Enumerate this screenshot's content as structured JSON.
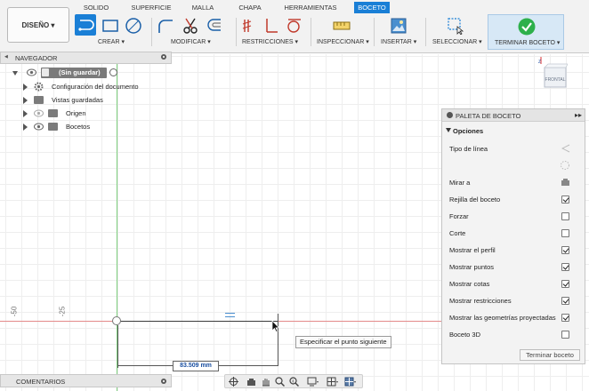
{
  "ribbon": {
    "tabs": [
      "SOLIDO",
      "SUPERFICIE",
      "MALLA",
      "CHAPA",
      "HERRAMIENTAS",
      "BOCETO"
    ],
    "design_button": "DISEÑO ▾",
    "groups": {
      "create": "CREAR ▾",
      "modify": "MODIFICAR ▾",
      "constraints": "RESTRICCIONES ▾",
      "inspect": "INSPECCIONAR ▾",
      "insert": "INSERTAR ▾",
      "select": "SELECCIONAR ▾",
      "finish": "TERMINAR BOCETO ▾"
    }
  },
  "navigator": {
    "title": "NAVEGADOR",
    "items": [
      {
        "label": "(Sin guardar)"
      },
      {
        "label": "Configuración del documento"
      },
      {
        "label": "Vistas guardadas"
      },
      {
        "label": "Origen"
      },
      {
        "label": "Bocetos"
      }
    ]
  },
  "palette": {
    "title": "PALETA DE BOCETO",
    "section": "Opciones",
    "rows": [
      {
        "label": "Tipo de línea"
      },
      {
        "label": "Mirar a"
      },
      {
        "label": "Rejilla del boceto",
        "checked": true
      },
      {
        "label": "Forzar",
        "checked": false
      },
      {
        "label": "Corte",
        "checked": false
      },
      {
        "label": "Mostrar el perfil",
        "checked": true
      },
      {
        "label": "Mostrar puntos",
        "checked": true
      },
      {
        "label": "Mostrar cotas",
        "checked": true
      },
      {
        "label": "Mostrar restricciones",
        "checked": true
      },
      {
        "label": "Mostrar las geometrías proyectadas",
        "checked": true
      },
      {
        "label": "Boceto 3D",
        "checked": false
      }
    ],
    "finish_button": "Terminar boceto"
  },
  "canvas": {
    "tooltip": "Especificar el punto siguiente",
    "dimension_value": "83.509 mm",
    "ruler_labels": [
      "-50",
      "-25"
    ],
    "viewcube_label": "FRONTAL"
  },
  "comments": {
    "title": "COMENTARIOS"
  },
  "colors": {
    "accent": "#1a7fd6",
    "finish_green": "#2db04b",
    "axis_red": "#e05050",
    "axis_green": "#5cc05c"
  }
}
